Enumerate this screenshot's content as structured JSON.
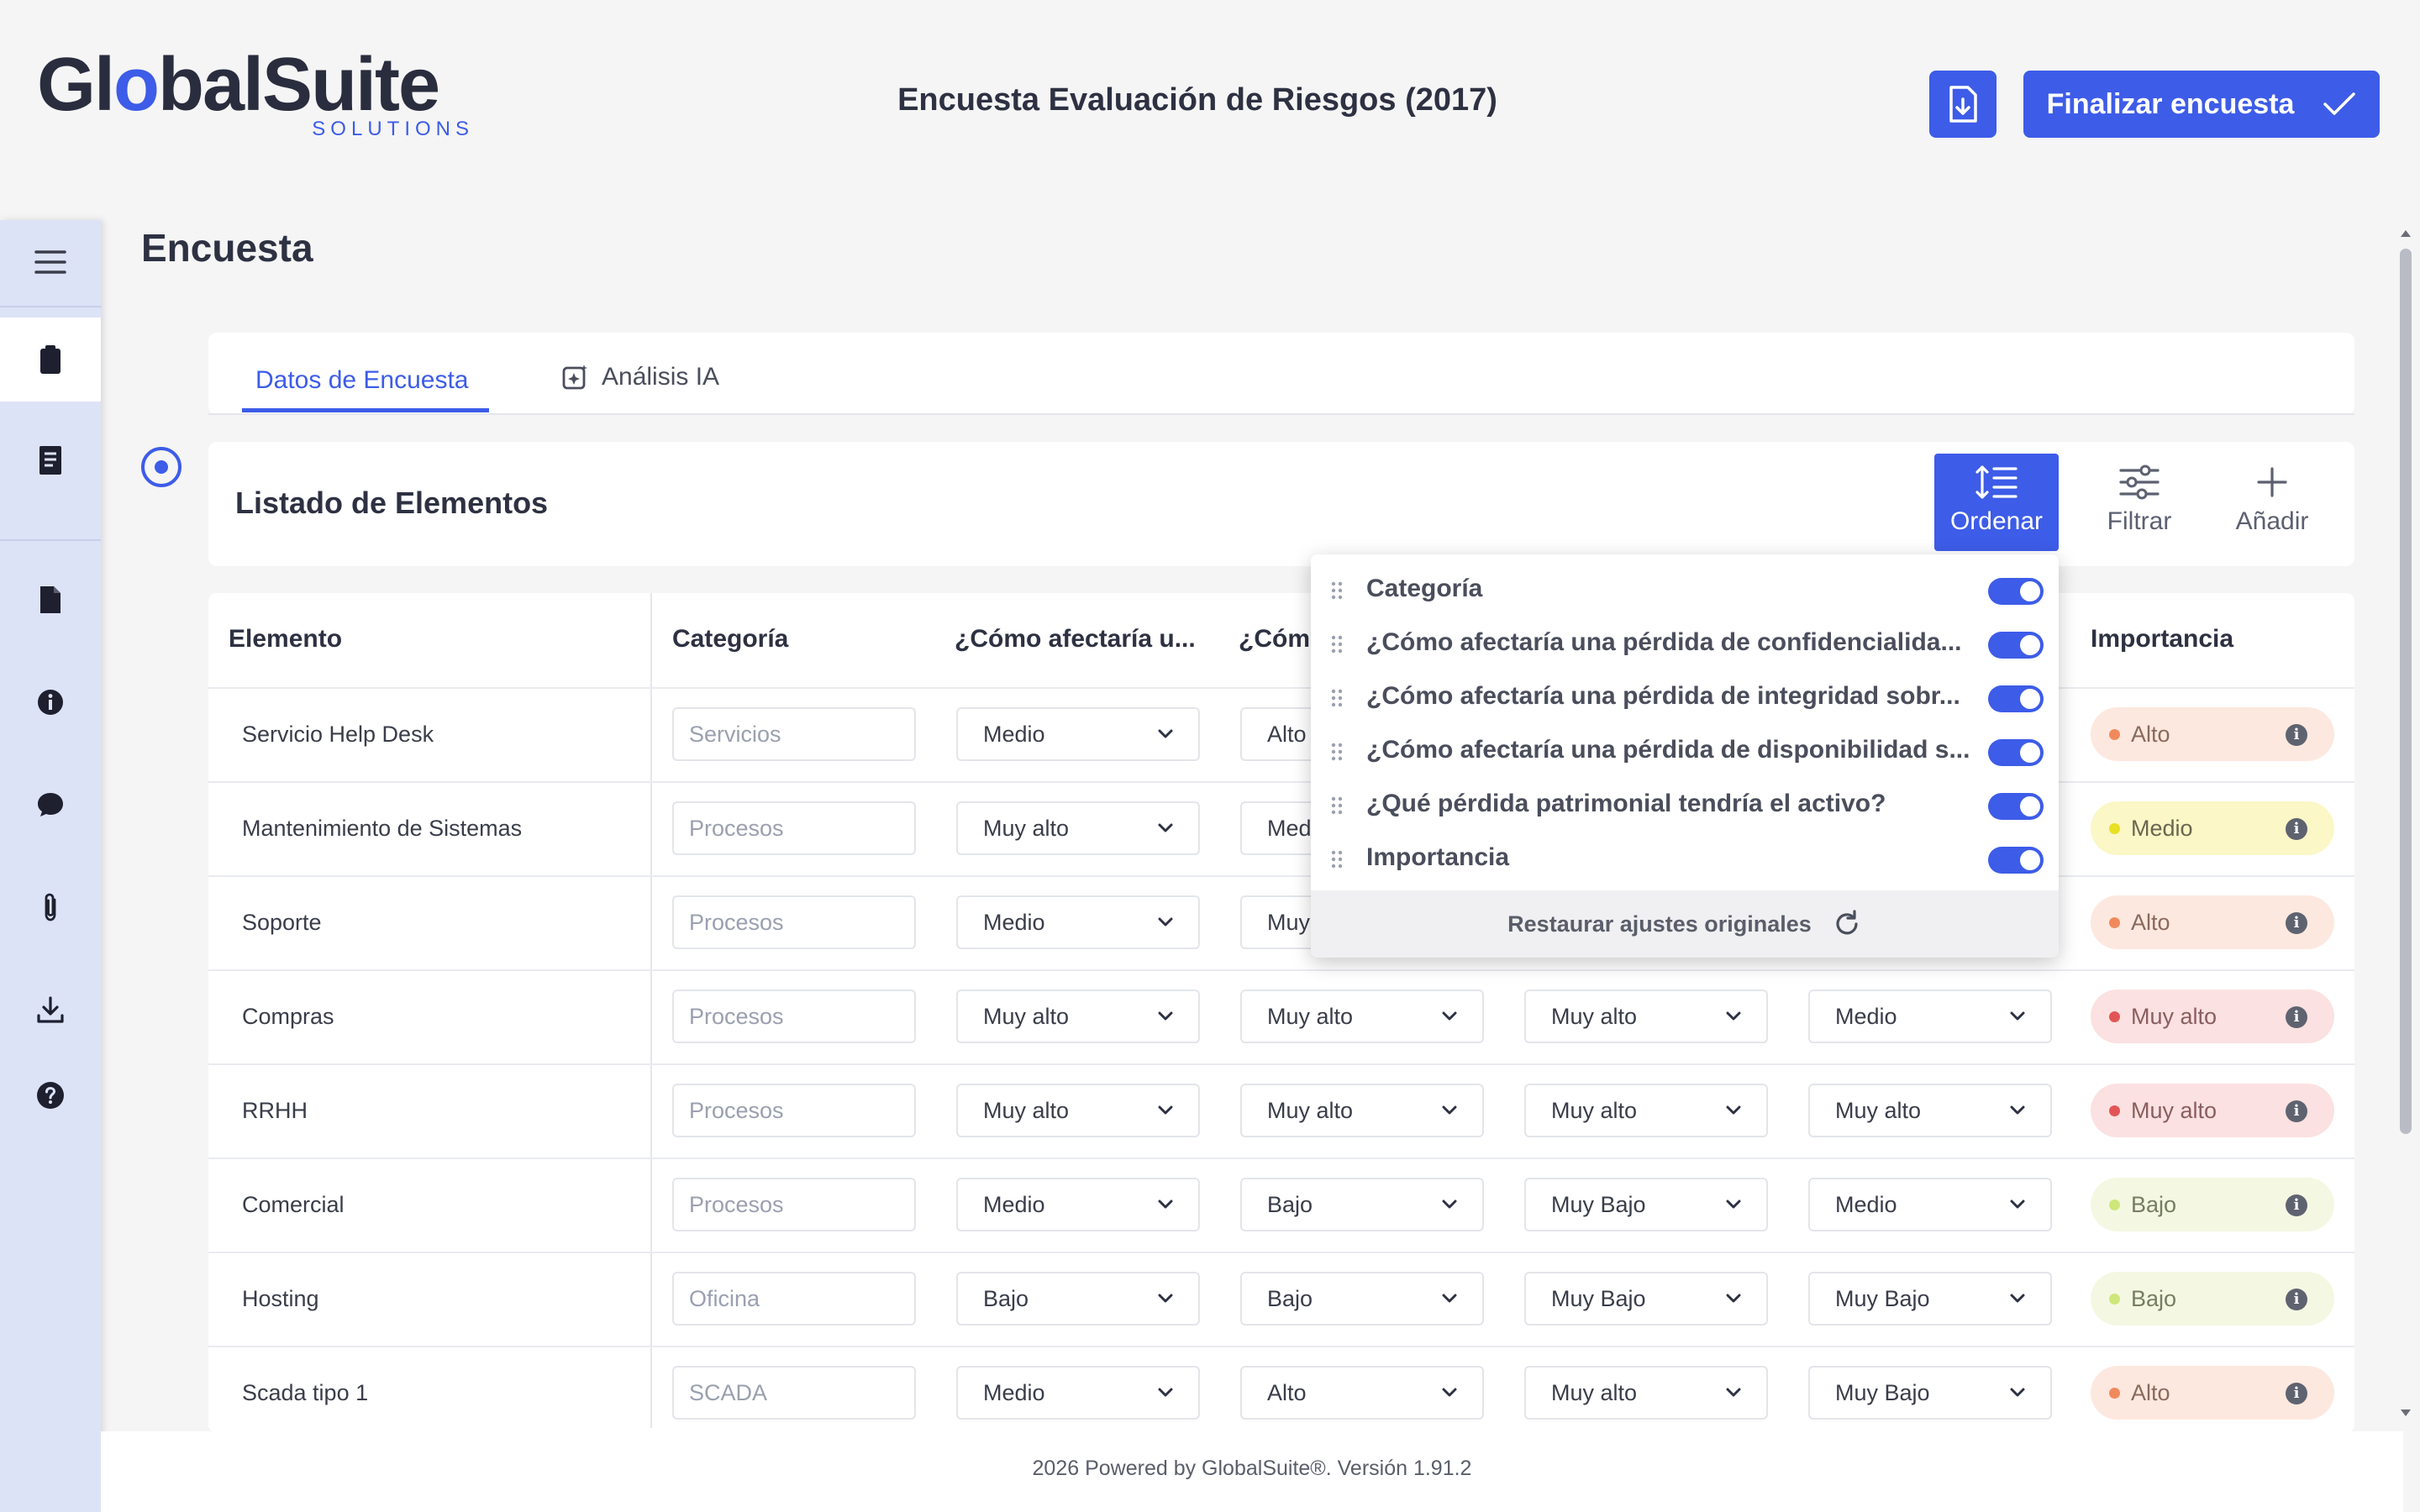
{
  "brand": {
    "name_part1": "Gl",
    "name_o": "o",
    "name_part2": "balSuite",
    "sub": "SOLUTIONS"
  },
  "header": {
    "title": "Encuesta Evaluación de Riesgos (2017)",
    "finish_label": "Finalizar encuesta"
  },
  "section_title": "Encuesta",
  "tabs": [
    {
      "label": "Datos de Encuesta"
    },
    {
      "label": "Análisis IA"
    }
  ],
  "list": {
    "title": "Listado de Elementos"
  },
  "toolbar": {
    "sort": "Ordenar",
    "filter": "Filtrar",
    "add": "Añadir"
  },
  "table": {
    "headers": [
      "Elemento",
      "Categoría",
      "¿Cómo afectaría u...",
      "¿Cóm",
      "Importancia"
    ],
    "rows": [
      {
        "elemento": "Servicio Help Desk",
        "categoria": "Servicios",
        "q1": "Medio",
        "q2": "Alto",
        "q3": "",
        "q4": "",
        "importancia": "Alto"
      },
      {
        "elemento": "Mantenimiento de Sistemas",
        "categoria": "Procesos",
        "q1": "Muy alto",
        "q2": "Med",
        "q3": "",
        "q4": "",
        "importancia": "Medio"
      },
      {
        "elemento": "Soporte",
        "categoria": "Procesos",
        "q1": "Medio",
        "q2": "Muy",
        "q3": "",
        "q4": "",
        "importancia": "Alto"
      },
      {
        "elemento": "Compras",
        "categoria": "Procesos",
        "q1": "Muy alto",
        "q2": "Muy alto",
        "q3": "Muy alto",
        "q4": "Medio",
        "importancia": "Muy alto"
      },
      {
        "elemento": "RRHH",
        "categoria": "Procesos",
        "q1": "Muy alto",
        "q2": "Muy alto",
        "q3": "Muy alto",
        "q4": "Muy alto",
        "importancia": "Muy alto"
      },
      {
        "elemento": "Comercial",
        "categoria": "Procesos",
        "q1": "Medio",
        "q2": "Bajo",
        "q3": "Muy Bajo",
        "q4": "Medio",
        "importancia": "Bajo"
      },
      {
        "elemento": "Hosting",
        "categoria": "Oficina",
        "q1": "Bajo",
        "q2": "Bajo",
        "q3": "Muy Bajo",
        "q4": "Muy Bajo",
        "importancia": "Bajo"
      },
      {
        "elemento": "Scada tipo 1",
        "categoria": "SCADA",
        "q1": "Medio",
        "q2": "Alto",
        "q3": "Muy alto",
        "q4": "Muy Bajo",
        "importancia": "Alto"
      }
    ]
  },
  "sort_popover": {
    "items": [
      {
        "label": "Categoría",
        "enabled": true
      },
      {
        "label": "¿Cómo afectaría una pérdida de confidencialida...",
        "enabled": true
      },
      {
        "label": "¿Cómo afectaría una pérdida de integridad sobr...",
        "enabled": true
      },
      {
        "label": "¿Cómo afectaría una pérdida de disponibilidad s...",
        "enabled": true
      },
      {
        "label": "¿Qué pérdida patrimonial tendría el activo?",
        "enabled": true
      },
      {
        "label": "Importancia",
        "enabled": true
      }
    ],
    "reset_label": "Restaurar ajustes originales"
  },
  "footer": {
    "text": "2026 Powered by GlobalSuite®. Versión 1.91.2"
  },
  "colors": {
    "accent": "#3d5ce8",
    "sidebar": "#dde3f7",
    "alto": "#f08a5d",
    "medio": "#e8e022",
    "muy_alto": "#e25555",
    "bajo": "#cfe67a"
  }
}
